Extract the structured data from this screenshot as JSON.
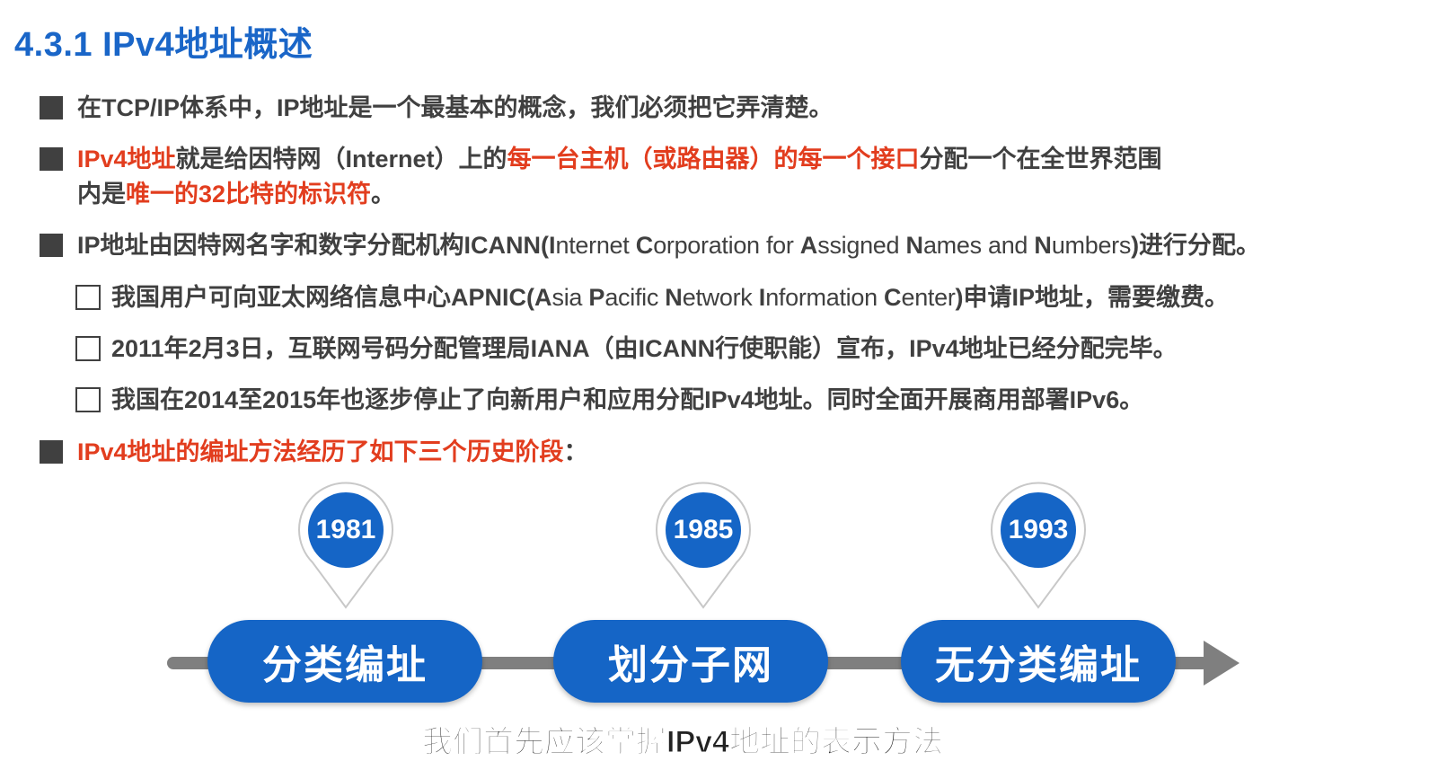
{
  "title": "4.3.1 IPv4地址概述",
  "bullets": {
    "b1": {
      "text": "在TCP/IP体系中，IP地址是一个最基本的概念，我们必须把它弄清楚。"
    },
    "b2": {
      "part1": "IPv4地址",
      "part2": "就是给因特网（Internet）上的",
      "part3": "每一台主机（或路由器）的每一个接口",
      "part4": "分配一个在全世界范围",
      "part5": "内是",
      "part6": "唯一的32比特的标识符",
      "part7": "。"
    },
    "b3": {
      "part1": "IP地址由因特网名字和数字分配机构ICANN(",
      "I": "I",
      "i_rest": "nternet ",
      "C": "C",
      "c_rest": "orporation for ",
      "A": "A",
      "a_rest": "ssigned ",
      "N": "N",
      "n_rest": "ames and ",
      "N2": "N",
      "n2_rest": "umbers",
      "part_end": ")进行分配。"
    },
    "s1": {
      "part1": "我国用户可向亚太网络信息中心APNIC(",
      "A": "A",
      "a_rest": "sia ",
      "P": "P",
      "p_rest": "acific ",
      "N": "N",
      "n_rest": "etwork ",
      "I": "I",
      "i_rest": "nformation ",
      "C": "C",
      "c_rest": "enter",
      "part_end": ")申请IP地址，需要缴费。"
    },
    "s2": {
      "text": "2011年2月3日，互联网号码分配管理局IANA（由ICANN行使职能）宣布，IPv4地址已经分配完毕。"
    },
    "s3": {
      "text": "我国在2014至2015年也逐步停止了向新用户和应用分配IPv4地址。同时全面开展商用部署IPv6。"
    },
    "b4": {
      "text": "IPv4地址的编址方法经历了如下三个历史阶段",
      "colon": "："
    }
  },
  "timeline": {
    "stages": [
      {
        "year": "1981",
        "label": "分类编址"
      },
      {
        "year": "1985",
        "label": "划分子网"
      },
      {
        "year": "1993",
        "label": "无分类编址"
      }
    ]
  },
  "caption": "我们首先应该掌握IPv4地址的表示方法",
  "colors": {
    "title": "#1a66c8",
    "highlight": "#e23d1e",
    "pill": "#1565c6",
    "timeline": "#7f7f7f"
  }
}
